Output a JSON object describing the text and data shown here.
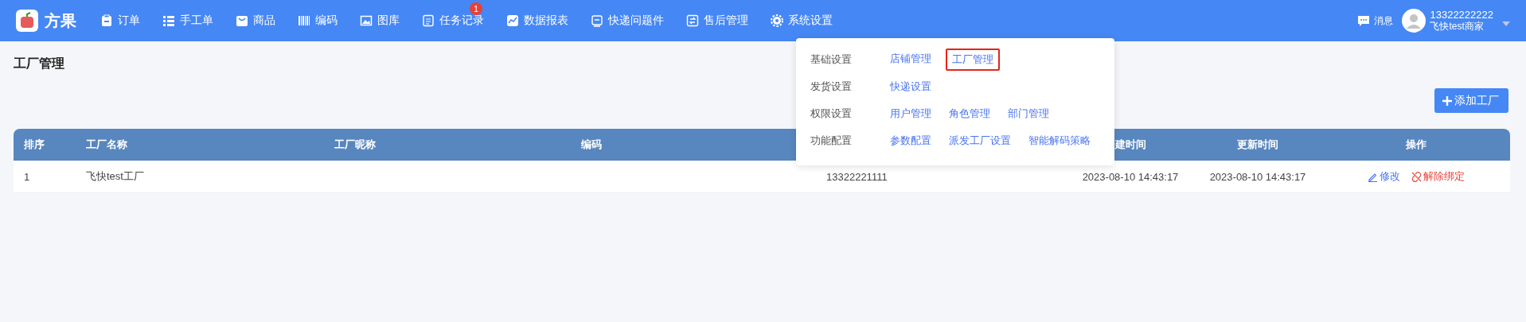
{
  "logo": {
    "text": "方果"
  },
  "nav": [
    {
      "label": "订单"
    },
    {
      "label": "手工单"
    },
    {
      "label": "商品"
    },
    {
      "label": "编码"
    },
    {
      "label": "图库"
    },
    {
      "label": "任务记录",
      "badge": "1"
    },
    {
      "label": "数据报表"
    },
    {
      "label": "快递问题件"
    },
    {
      "label": "售后管理"
    },
    {
      "label": "系统设置"
    }
  ],
  "user": {
    "messages": "消息",
    "phone": "13322222222",
    "name": "飞快test商家"
  },
  "page_title": "工厂管理",
  "add_button": "添加工厂",
  "table": {
    "columns": [
      "排序",
      "工厂名称",
      "工厂昵称",
      "编码",
      "",
      "建时间",
      "更新时间",
      "操作"
    ],
    "rows": [
      {
        "cells": [
          "1",
          "飞快test工厂",
          "",
          "",
          "13322221111",
          "2023-08-10 14:43:17",
          "2023-08-10 14:43:17"
        ],
        "actions": [
          "修改",
          "解除绑定"
        ]
      }
    ]
  },
  "settings_menu": [
    {
      "group": "基础设置",
      "links": [
        {
          "label": "店铺管理",
          "selected": false
        },
        {
          "label": "工厂管理",
          "selected": true
        }
      ]
    },
    {
      "group": "发货设置",
      "links": [
        {
          "label": "快递设置",
          "selected": false
        }
      ]
    },
    {
      "group": "权限设置",
      "links": [
        {
          "label": "用户管理",
          "selected": false
        },
        {
          "label": "角色管理",
          "selected": false
        },
        {
          "label": "部门管理",
          "selected": false
        }
      ]
    },
    {
      "group": "功能配置",
      "links": [
        {
          "label": "参数配置",
          "selected": false
        },
        {
          "label": "派发工厂设置",
          "selected": false
        },
        {
          "label": "智能解码策略",
          "selected": false
        }
      ]
    }
  ]
}
